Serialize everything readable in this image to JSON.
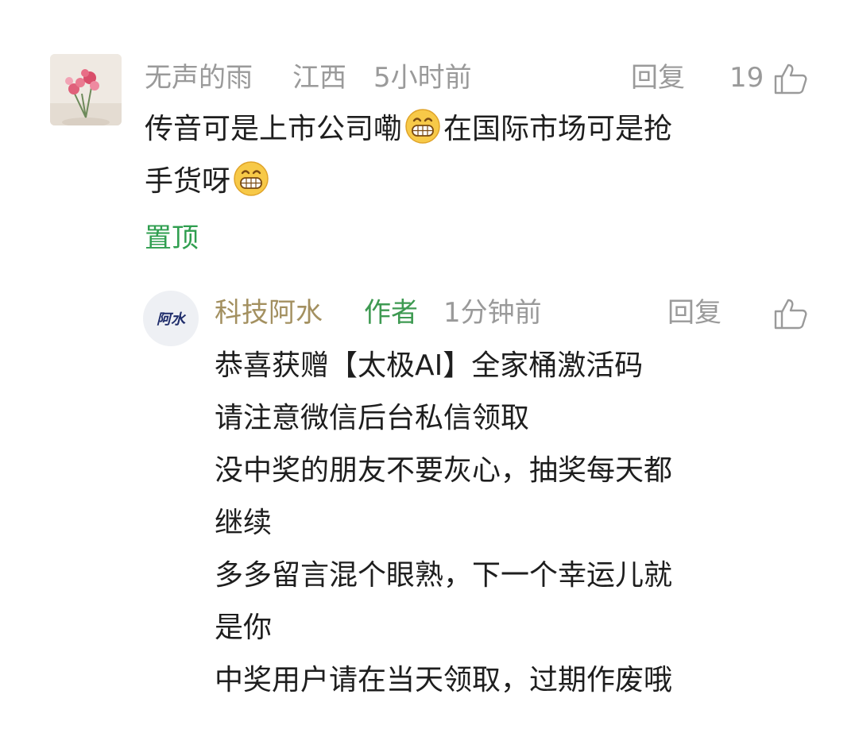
{
  "comment": {
    "username": "无声的雨",
    "location": "江西",
    "time": "5小时前",
    "reply_label": "回复",
    "like_count": "19",
    "text_part1": "传音可是上市公司嘞",
    "text_part2": "在国际市场可是抢",
    "text_part3": "手货呀",
    "pin_label": "置顶",
    "emoji_icon": "grinning-face-icon"
  },
  "reply": {
    "avatar_text": "阿水",
    "username": "科技阿水",
    "author_badge": "作者",
    "time": "1分钟前",
    "reply_label": "回复",
    "lines": [
      "恭喜获赠【太极AI】全家桶激活码",
      "请注意微信后台私信领取",
      "没中奖的朋友不要灰心，抽奖每天都",
      "继续",
      "多多留言混个眼熟，下一个幸运儿就",
      "是你",
      "中奖用户请在当天领取，过期作废哦"
    ]
  },
  "colors": {
    "meta_gray": "#9a9a9a",
    "author_name": "#a39060",
    "author_badge": "#3e9a52",
    "pin_green": "#2f9e4f",
    "text": "#1e1e1e"
  }
}
